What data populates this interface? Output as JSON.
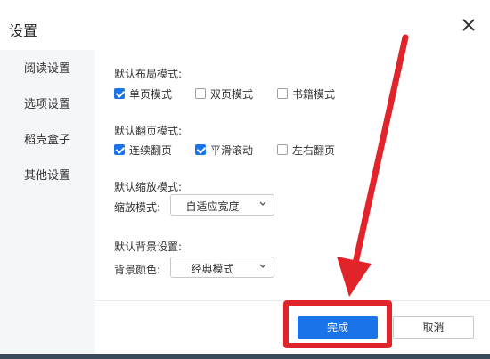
{
  "dialog": {
    "title": "设置",
    "close_icon": "close-icon"
  },
  "sidebar": {
    "items": [
      {
        "label": "阅读设置",
        "active": true
      },
      {
        "label": "选项设置",
        "active": false
      },
      {
        "label": "稻壳盒子",
        "active": false
      },
      {
        "label": "其他设置",
        "active": false
      }
    ]
  },
  "layout_mode": {
    "label": "默认布局模式:",
    "options": [
      {
        "label": "单页模式",
        "checked": true
      },
      {
        "label": "双页模式",
        "checked": false
      },
      {
        "label": "书籍模式",
        "checked": false
      }
    ]
  },
  "page_turn_mode": {
    "label": "默认翻页模式:",
    "options": [
      {
        "label": "连续翻页",
        "checked": true
      },
      {
        "label": "平滑滚动",
        "checked": true
      },
      {
        "label": "左右翻页",
        "checked": false
      }
    ]
  },
  "zoom_mode": {
    "label": "默认缩放模式:",
    "field_label": "缩放模式:",
    "value": "自适应宽度"
  },
  "background": {
    "label": "默认背景设置:",
    "field_label": "背景颜色:",
    "value": "经典模式"
  },
  "footer": {
    "ok_label": "完成",
    "cancel_label": "取消"
  },
  "colors": {
    "accent": "#1a73e8",
    "annotation": "#e0242a"
  }
}
